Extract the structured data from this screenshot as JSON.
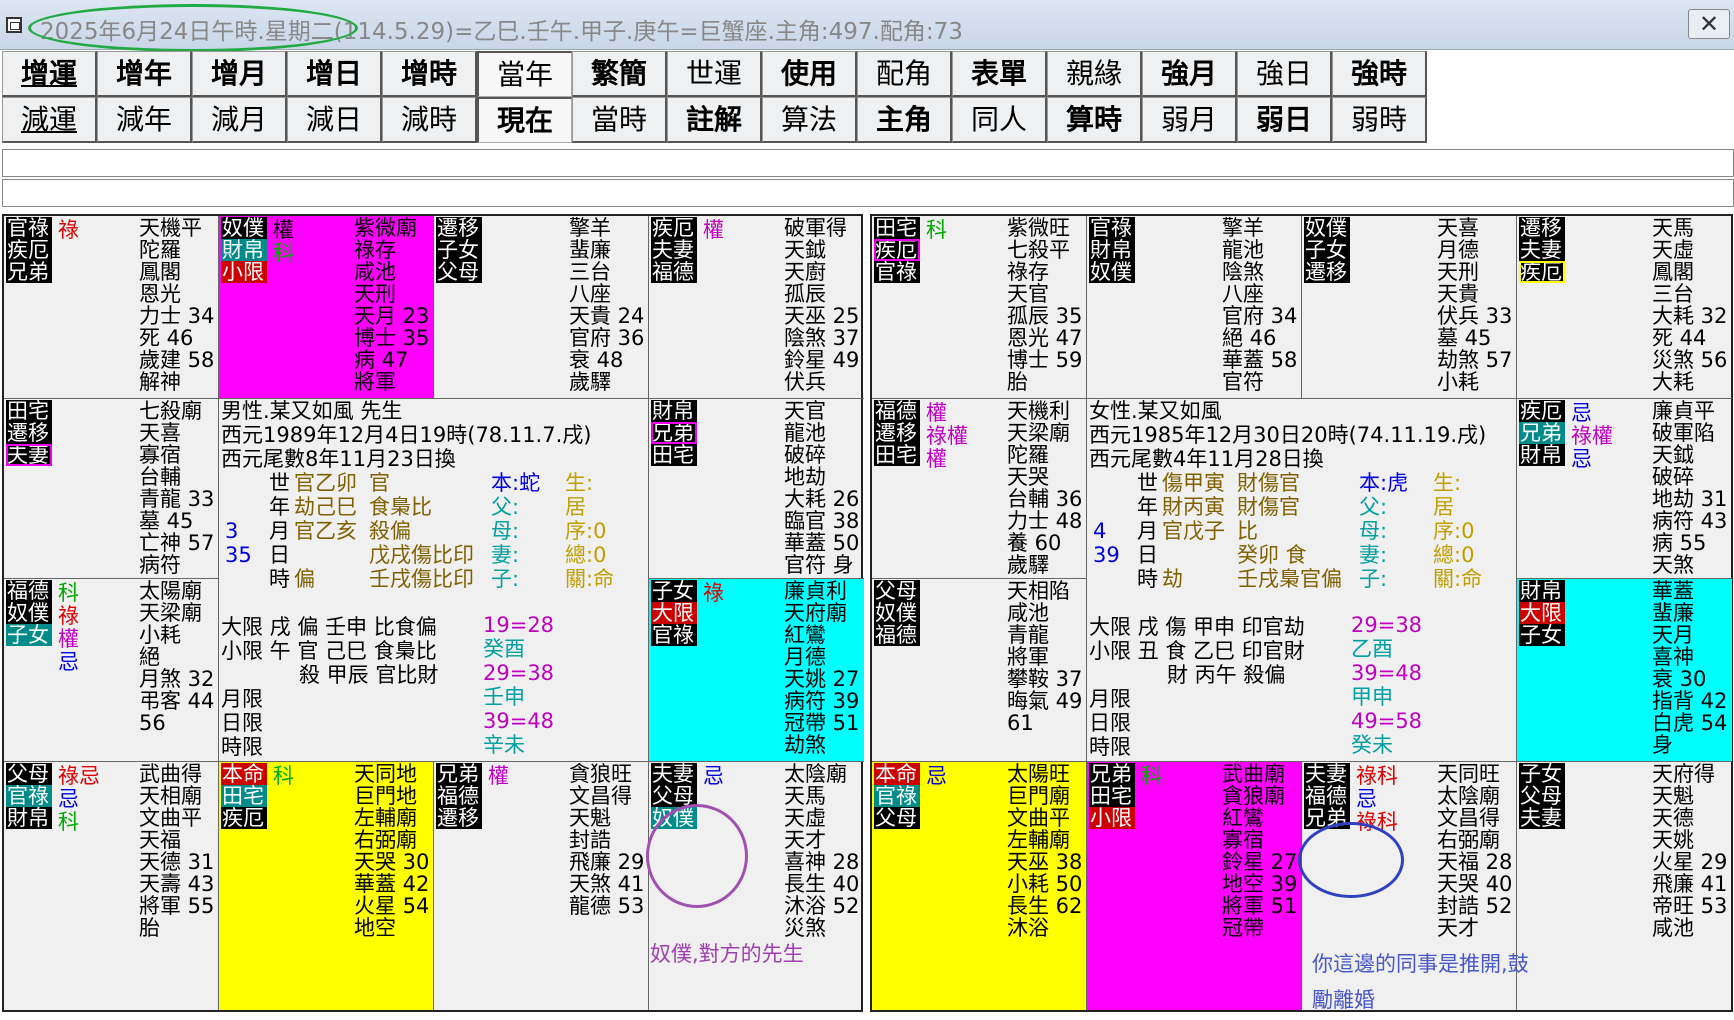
{
  "window": {
    "title": "2025年6月24日午時.星期二(114.5.29)=乙巳.壬午.甲子.庚午=巨蟹座.主角:497.配角:73",
    "close_glyph": "✕"
  },
  "toolbar": {
    "row1": [
      "增運",
      "增年",
      "增月",
      "增日",
      "增時",
      "當年",
      "繁簡",
      "世運",
      "使用",
      "配角",
      "表單",
      "親緣",
      "強月",
      "強日",
      "強時"
    ],
    "row2": [
      "減運",
      "減年",
      "減月",
      "減日",
      "減時",
      "現在",
      "當時",
      "註解",
      "算法",
      "主角",
      "同人",
      "算時",
      "弱月",
      "弱日",
      "弱時"
    ]
  },
  "input1": "",
  "input2": "",
  "colors": {
    "magenta": "#ff00ff",
    "cyan": "#00ffff",
    "yellow": "#ffff00",
    "teal_tag": "#008b8b",
    "red_tag": "#cc0000",
    "green_oval": "#22aa44",
    "purple_oval": "#a050b0",
    "blue_oval": "#3040c0"
  },
  "left": {
    "cells": [
      {
        "tags": [
          {
            "t": "官祿"
          },
          {
            "t": "疾厄"
          },
          {
            "t": "兄弟"
          }
        ],
        "marks": [
          {
            "t": "祿",
            "c": "#e00000"
          }
        ],
        "stars": [
          "天機平",
          "陀羅",
          "鳳閣",
          "恩光",
          "力士 34",
          "死 46",
          "歲建 58",
          "解神"
        ]
      },
      {
        "bg": "#ff00ff",
        "tags": [
          {
            "t": "奴僕"
          },
          {
            "t": "財帛",
            "k": "teal"
          },
          {
            "t": "小限",
            "k": "red"
          }
        ],
        "marks": [
          {
            "t": "權",
            "c": "#000"
          },
          {
            "t": "科",
            "c": "#00aa00"
          }
        ],
        "stars": [
          "紫微廟",
          "祿存",
          "咸池",
          "天刑",
          "天月 23",
          "博士 35",
          "病 47",
          "將軍"
        ]
      },
      {
        "tags": [
          {
            "t": "遷移"
          },
          {
            "t": "子女"
          },
          {
            "t": "父母"
          }
        ],
        "marks": [],
        "stars": [
          "擎羊",
          "蜚廉",
          "三台",
          "八座",
          "天貴 24",
          "官府 36",
          "衰 48",
          "歲驛"
        ]
      },
      {
        "tags": [
          {
            "t": "疾厄"
          },
          {
            "t": "夫妻"
          },
          {
            "t": "福德"
          }
        ],
        "marks": [
          {
            "t": "權",
            "c": "#c000c0"
          }
        ],
        "stars": [
          "破軍得",
          "天鉞",
          "天廚",
          "孤辰",
          "天巫 25",
          "陰煞 37",
          "鈴星 49",
          "伏兵"
        ]
      },
      {
        "tags": [
          {
            "t": "田宅"
          },
          {
            "t": "遷移"
          },
          {
            "t": "夫妻",
            "k": "mg"
          }
        ],
        "marks": [],
        "stars": [
          "七殺廟",
          "天喜",
          "寡宿",
          "台輔",
          "青龍 33",
          "墓 45",
          "亡神 57",
          "病符"
        ]
      },
      {
        "tags": [
          {
            "t": "財帛"
          },
          {
            "t": "兄弟",
            "k": "mg"
          },
          {
            "t": "田宅"
          }
        ],
        "marks": [],
        "stars": [
          "天官",
          "龍池",
          "破碎",
          "地劫",
          "大耗 26",
          "臨官 38",
          "華蓋 50",
          "官符 身"
        ]
      },
      {
        "tags": [
          {
            "t": "福德"
          },
          {
            "t": "奴僕"
          },
          {
            "t": "子女",
            "k": "teal"
          }
        ],
        "marks": [
          {
            "t": "科",
            "c": "#00aa00"
          },
          {
            "t": "祿",
            "c": "#e00000"
          },
          {
            "t": "權",
            "c": "#c000c0"
          },
          {
            "t": "忌",
            "c": "#0000e0"
          }
        ],
        "stars": [
          "太陽廟",
          "天梁廟",
          "小耗",
          "絕",
          "月煞 32",
          "弔客 44",
          "56"
        ]
      },
      {
        "bg": "#00ffff",
        "tags": [
          {
            "t": "子女"
          },
          {
            "t": "大限",
            "k": "red"
          },
          {
            "t": "官祿"
          }
        ],
        "marks": [
          {
            "t": "祿",
            "c": "#e00000"
          }
        ],
        "stars": [
          "廉貞利",
          "天府廟",
          "紅鸞",
          "月德",
          "天姚 27",
          "病符 39",
          "冠帶 51",
          "劫煞"
        ]
      },
      {
        "tags": [
          {
            "t": "父母"
          },
          {
            "t": "官祿",
            "k": "teal"
          },
          {
            "t": "財帛"
          }
        ],
        "marks": [
          {
            "t": "祿忌",
            "c": "#e00000"
          },
          {
            "t": "忌",
            "c": "#0000e0"
          },
          {
            "t": "科",
            "c": "#00aa00"
          }
        ],
        "stars": [
          "武曲得",
          "天相廟",
          "文曲平",
          "天福",
          "天德 31",
          "天壽 43",
          "將軍 55",
          "胎"
        ]
      },
      {
        "bg": "#ffff00",
        "tags": [
          {
            "t": "本命",
            "k": "red"
          },
          {
            "t": "田宅",
            "k": "teal"
          },
          {
            "t": "疾厄"
          }
        ],
        "marks": [
          {
            "t": "科",
            "c": "#00aa00"
          }
        ],
        "stars": [
          "天同地",
          "巨門地",
          "左輔廟",
          "右弼廟",
          "天哭 30",
          "華蓋 42",
          "火星 54",
          "地空"
        ]
      },
      {
        "tags": [
          {
            "t": "兄弟"
          },
          {
            "t": "福德"
          },
          {
            "t": "遷移"
          }
        ],
        "marks": [
          {
            "t": "權",
            "c": "#c000c0"
          }
        ],
        "stars": [
          "貪狼旺",
          "文昌得",
          "天魁",
          "封誥",
          "飛廉 29",
          "天煞 41",
          "龍德 53"
        ]
      },
      {
        "tags": [
          {
            "t": "夫妻"
          },
          {
            "t": "父母"
          },
          {
            "t": "奴僕",
            "k": "teal"
          }
        ],
        "marks": [
          {
            "t": "忌",
            "c": "#0000e0"
          }
        ],
        "stars": [
          "太陰廟",
          "天馬",
          "天虛",
          "天才",
          "喜神 28",
          "長生 40",
          "沐浴 52",
          "災煞"
        ]
      }
    ],
    "center": {
      "lines": [
        "男性.某又如風 先生",
        "西元1989年12月4日19時(78.11.7.戌)",
        "西元尾數8年11月23日換"
      ],
      "pillars": [
        [
          "世",
          "官乙卯",
          "官"
        ],
        [
          "年",
          "劫己巳",
          "食梟比"
        ],
        [
          "月",
          "官乙亥",
          "殺偏"
        ],
        [
          "日",
          "",
          "戊戌傷比印"
        ],
        [
          "時",
          "偏",
          "壬戌傷比印"
        ]
      ],
      "side_nums": [
        "3",
        "35"
      ],
      "fam1": [
        "本:蛇",
        "父:",
        "母:",
        "妻:",
        "子:"
      ],
      "fam2": [
        "生:",
        "居",
        "序:0",
        "總:0",
        "關:命"
      ],
      "dx1": "大限 戌 偏 壬申 比食偏",
      "dx2": "小限 午 官 己巳 食梟比",
      "dx3": "殺 甲辰 官比財",
      "ranges": [
        "19=28",
        "癸酉",
        "29=38",
        "壬申",
        "39=48",
        "辛未"
      ],
      "bottom": [
        "月限",
        "日限",
        "時限"
      ]
    }
  },
  "right": {
    "cells": [
      {
        "tags": [
          {
            "t": "田宅"
          },
          {
            "t": "疾厄",
            "k": "mg"
          },
          {
            "t": "官祿"
          }
        ],
        "marks": [
          {
            "t": "科",
            "c": "#00aa00"
          }
        ],
        "stars": [
          "紫微旺",
          "七殺平",
          "祿存",
          "天官",
          "孤辰 35",
          "恩光 47",
          "博士 59",
          "胎"
        ]
      },
      {
        "tags": [
          {
            "t": "官祿"
          },
          {
            "t": "財帛"
          },
          {
            "t": "奴僕"
          }
        ],
        "marks": [],
        "stars": [
          "擎羊",
          "龍池",
          "陰煞",
          "八座",
          "官府 34",
          "絕 46",
          "華蓋 58",
          "官符"
        ]
      },
      {
        "tags": [
          {
            "t": "奴僕"
          },
          {
            "t": "子女"
          },
          {
            "t": "遷移"
          }
        ],
        "marks": [],
        "stars": [
          "天喜",
          "月德",
          "天刑",
          "天貴",
          "伏兵 33",
          "墓 45",
          "劫煞 57",
          "小耗"
        ]
      },
      {
        "tags": [
          {
            "t": "遷移"
          },
          {
            "t": "夫妻"
          },
          {
            "t": "疾厄",
            "k": "yl"
          }
        ],
        "marks": [],
        "stars": [
          "天馬",
          "天虛",
          "鳳閣",
          "三台",
          "大耗 32",
          "死 44",
          "災煞 56",
          "大耗"
        ]
      },
      {
        "tags": [
          {
            "t": "福德"
          },
          {
            "t": "遷移"
          },
          {
            "t": "田宅"
          }
        ],
        "marks": [
          {
            "t": "權",
            "c": "#c000c0"
          },
          {
            "t": "祿權",
            "c": "#c000c0"
          },
          {
            "t": "權",
            "c": "#c000c0"
          }
        ],
        "stars": [
          "天機利",
          "天梁廟",
          "陀羅",
          "天哭",
          "台輔 36",
          "力士 48",
          "養 60",
          "歲驛"
        ]
      },
      {
        "tags": [
          {
            "t": "疾厄"
          },
          {
            "t": "兄弟",
            "k": "teal"
          },
          {
            "t": "財帛"
          }
        ],
        "marks": [
          {
            "t": "忌",
            "c": "#0000e0"
          },
          {
            "t": "祿權",
            "c": "#c000c0"
          },
          {
            "t": "忌",
            "c": "#0000e0"
          }
        ],
        "stars": [
          "廉貞平",
          "破軍陷",
          "天鉞",
          "破碎",
          "地劫 31",
          "病符 43",
          "病 55",
          "天煞"
        ]
      },
      {
        "tags": [
          {
            "t": "父母"
          },
          {
            "t": "奴僕"
          },
          {
            "t": "福德"
          }
        ],
        "marks": [],
        "stars": [
          "天相陷",
          "咸池",
          "青龍",
          "將軍",
          "攀鞍 37",
          "晦氣 49",
          "61"
        ]
      },
      {
        "bg": "#00ffff",
        "tags": [
          {
            "t": "財帛"
          },
          {
            "t": "大限",
            "k": "red"
          },
          {
            "t": "子女"
          }
        ],
        "marks": [],
        "stars": [
          "華蓋",
          "蜚廉",
          "天月",
          "喜神",
          "衰 30",
          "指背 42",
          "白虎 54",
          "身"
        ]
      },
      {
        "bg": "#ffff00",
        "tags": [
          {
            "t": "本命",
            "k": "red"
          },
          {
            "t": "官祿",
            "k": "teal"
          },
          {
            "t": "父母"
          }
        ],
        "marks": [
          {
            "t": "忌",
            "c": "#0000e0"
          }
        ],
        "stars": [
          "太陽旺",
          "巨門廟",
          "文曲平",
          "左輔廟",
          "天巫 38",
          "小耗 50",
          "長生 62",
          "沐浴"
        ]
      },
      {
        "bg": "#ff00ff",
        "tags": [
          {
            "t": "兄弟"
          },
          {
            "t": "田宅"
          },
          {
            "t": "小限",
            "k": "red"
          }
        ],
        "marks": [
          {
            "t": "科",
            "c": "#00aa00"
          }
        ],
        "stars": [
          "武曲廟",
          "貪狼廟",
          "紅鸞",
          "寡宿",
          "鈴星 27",
          "地空 39",
          "將軍 51",
          "冠帶"
        ]
      },
      {
        "tags": [
          {
            "t": "夫妻"
          },
          {
            "t": "福德"
          },
          {
            "t": "兄弟"
          }
        ],
        "marks": [
          {
            "t": "祿科",
            "c": "#e00000"
          },
          {
            "t": "忌",
            "c": "#0000e0"
          },
          {
            "t": "祿科",
            "c": "#e00000"
          }
        ],
        "stars": [
          "天同旺",
          "太陰廟",
          "文昌得",
          "右弼廟",
          "天福 28",
          "天哭 40",
          "封誥 52",
          "天才"
        ]
      },
      {
        "tags": [
          {
            "t": "子女"
          },
          {
            "t": "父母"
          },
          {
            "t": "夫妻"
          }
        ],
        "marks": [],
        "stars": [
          "天府得",
          "天魁",
          "天德",
          "天姚",
          "火星 29",
          "飛廉 41",
          "帝旺 53",
          "咸池"
        ]
      }
    ],
    "center": {
      "lines": [
        "女性.某又如風",
        "西元1985年12月30日20時(74.11.19.戌)",
        "西元尾數4年11月28日換"
      ],
      "pillars": [
        [
          "世",
          "傷甲寅",
          "財傷官"
        ],
        [
          "年",
          "財丙寅",
          "財傷官"
        ],
        [
          "月",
          "官戊子",
          "比"
        ],
        [
          "日",
          "",
          "癸卯 食"
        ],
        [
          "時",
          "劫",
          "壬戌梟官偏"
        ]
      ],
      "side_nums": [
        "4",
        "39"
      ],
      "fam1": [
        "本:虎",
        "父:",
        "母:",
        "妻:",
        "子:"
      ],
      "fam2": [
        "生:",
        "居",
        "序:0",
        "總:0",
        "關:命"
      ],
      "dx1": "大限 戌 傷 甲申 印官劫",
      "dx2": "小限 丑 食 乙巳 印官財",
      "dx3": "財 丙午 殺偏",
      "ranges": [
        "29=38",
        "乙酉",
        "39=48",
        "甲申",
        "49=58",
        "癸未"
      ],
      "bottom": [
        "月限",
        "日限",
        "時限"
      ]
    }
  },
  "annotations": {
    "left_note": "奴僕,對方的先生",
    "right_note_l1": "你這邊的同事是推開,鼓",
    "right_note_l2": "勵離婚"
  }
}
